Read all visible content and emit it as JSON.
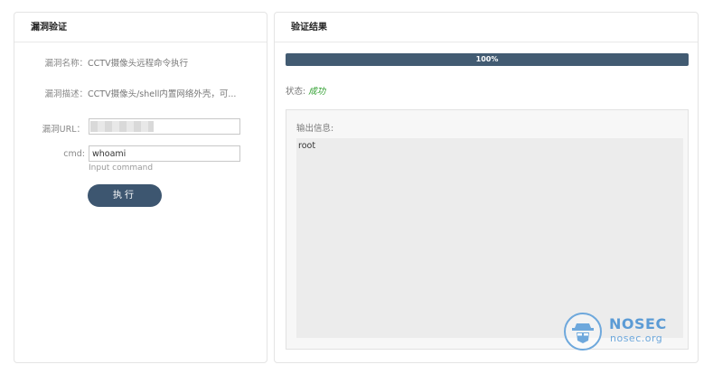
{
  "left_panel": {
    "title": "漏洞验证",
    "vuln_name_label": "漏洞名称：",
    "vuln_name": "CCTV摄像头远程命令执行",
    "vuln_desc_label": "漏洞描述：",
    "vuln_desc": "CCTV摄像头/shell内置网络外壳，可...",
    "url_label": "漏洞URL：",
    "url_value": "",
    "cmd_label": "cmd:",
    "cmd_value": "whoami",
    "cmd_hint": "Input command",
    "execute_label": "执行"
  },
  "right_panel": {
    "title": "验证结果",
    "progress_label": "100%",
    "progress_fraction": 1.0,
    "status_label": "状态:",
    "status_value": "成功",
    "output_title": "输出信息:",
    "output_text": "root"
  },
  "watermark": {
    "brand": "NOSEC",
    "domain": "nosec.org"
  },
  "colors": {
    "accent": "#3d5670",
    "progress": "#425b72",
    "success": "#2e9e2e",
    "watermark": "#5b9bd5"
  },
  "icons": {
    "watermark_logo": "detective-icon"
  }
}
